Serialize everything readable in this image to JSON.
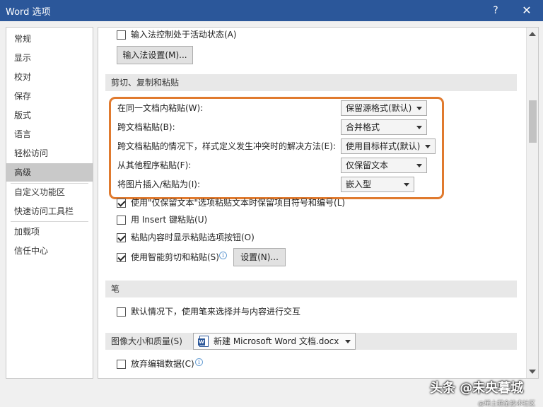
{
  "window": {
    "title": "Word 选项",
    "help_label": "?",
    "close_label": "✕"
  },
  "sidebar": {
    "items": [
      {
        "label": "常规"
      },
      {
        "label": "显示"
      },
      {
        "label": "校对"
      },
      {
        "label": "保存"
      },
      {
        "label": "版式"
      },
      {
        "label": "语言"
      },
      {
        "label": "轻松访问"
      },
      {
        "label": "高级",
        "selected": true
      },
      {
        "label": "自定义功能区"
      },
      {
        "label": "快速访问工具栏"
      },
      {
        "label": "加载项"
      },
      {
        "label": "信任中心"
      }
    ]
  },
  "ime": {
    "checkbox_label": "输入法控制处于活动状态(A)",
    "checked": false,
    "settings_button": "输入法设置(M)..."
  },
  "cut_copy_paste": {
    "header": "剪切、复制和粘贴",
    "paste_options": [
      {
        "label": "在同一文档内粘贴(W):",
        "value": "保留源格式(默认)"
      },
      {
        "label": "跨文档粘贴(B):",
        "value": "合并格式"
      },
      {
        "label": "跨文档粘贴的情况下，样式定义发生冲突时的解决方法(E):",
        "value": "使用目标样式(默认)"
      },
      {
        "label": "从其他程序粘贴(F):",
        "value": "仅保留文本"
      },
      {
        "label": "将图片插入/粘贴为(I):",
        "value": "嵌入型"
      }
    ],
    "checkboxes": [
      {
        "label": "使用\"仅保留文本\"选项粘贴文本时保留项目符号和编号(L)",
        "checked": true
      },
      {
        "label": "用 Insert 键粘贴(U)",
        "checked": false
      },
      {
        "label": "粘贴内容时显示粘贴选项按钮(O)",
        "checked": true
      },
      {
        "label": "使用智能剪切和粘贴(S)",
        "checked": true
      }
    ],
    "settings_button": "设置(N)..."
  },
  "pen": {
    "header": "笔",
    "checkbox_label": "默认情况下，使用笔来选择并与内容进行交互",
    "checked": false
  },
  "image": {
    "header": "图像大小和质量(S)",
    "document_select": "新建 Microsoft Word 文档.docx",
    "checkbox_label": "放弃编辑数据(C)",
    "checked": false
  },
  "watermark": {
    "main": "头条 @未央暮城",
    "sub": "@稀土掘金技术社区"
  },
  "colors": {
    "titlebar": "#2b579a",
    "highlight": "#e07a2e",
    "selected_nav": "#c9c9c9"
  }
}
